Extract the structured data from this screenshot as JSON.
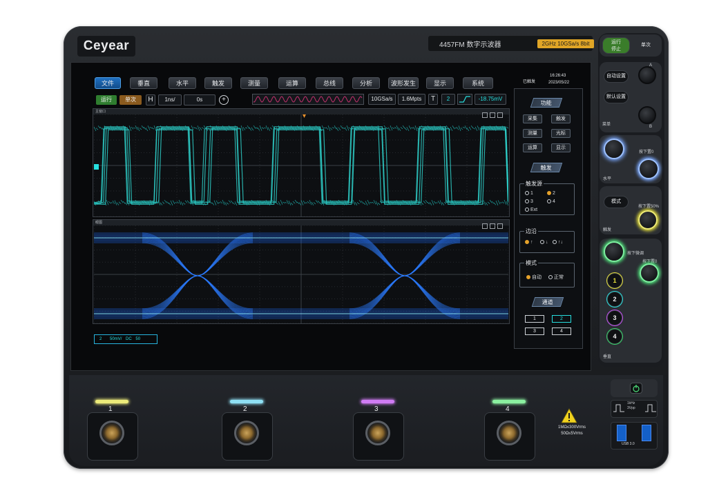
{
  "device": {
    "brand": "Ceyear",
    "model": "4457FM 数字示波器",
    "spec": "2GHz 10GSa/s 8bit",
    "run_stop": "运行\n停止",
    "single": "单次"
  },
  "menu": [
    "文件",
    "垂直",
    "水平",
    "触发",
    "测量",
    "运算",
    "总线",
    "分析",
    "波形发生",
    "显示",
    "系统"
  ],
  "status": {
    "trig_state": "已触发",
    "time": "16:26:43",
    "date": "2023/05/22"
  },
  "toolbar": {
    "run": "运行",
    "single": "单次",
    "h_label": "H",
    "timebase": "1ns/",
    "delay": "0s",
    "plus": "+",
    "sample_rate": "10GSa/s",
    "memory": "1.6Mpts",
    "t_label": "T",
    "trig_ch": "2",
    "trig_level": "-18.75mV"
  },
  "windows": {
    "top_title": "主窗口",
    "bottom_title": "眼图",
    "channel_box": {
      "ch": "2",
      "scale": "50mV/",
      "coupling": "DC",
      "imp": "50"
    }
  },
  "side": {
    "func_head": "功能",
    "func_buttons": [
      "采集",
      "触发",
      "测量",
      "光标",
      "运算",
      "显示"
    ],
    "trig_head": "触发",
    "source_title": "触发源",
    "sources": [
      "1",
      "2",
      "3",
      "4",
      "Ext"
    ],
    "source_selected": "2",
    "edge_title": "边沿",
    "edge_options": [
      "↑",
      "↓",
      "↑↓"
    ],
    "mode_title": "模式",
    "mode_options": [
      "自动",
      "正常"
    ],
    "mode_selected": "自动",
    "channel_head": "通道",
    "channels": [
      "1",
      "2",
      "3",
      "4"
    ]
  },
  "right_panel": {
    "auto_setup": "自动设置",
    "default_setup": "默认设置",
    "knob_a": "A",
    "knob_b": "B",
    "multi_label": "菜单",
    "horizontal_label": "水平",
    "press_zero": "按下置0",
    "mode_btn": "模式",
    "press_50": "按下置50%",
    "trigger_label": "触发",
    "press_fine": "按下微调",
    "press_zero2": "按下置0",
    "vertical_label": "垂直",
    "channel_nums": [
      "1",
      "2",
      "3",
      "4"
    ],
    "channel_colors": [
      "#e8e23a",
      "#27e0e0",
      "#c24ef0",
      "#37d46a"
    ]
  },
  "front": {
    "inputs": [
      "1",
      "2",
      "3",
      "4"
    ],
    "warn_line1": "1MΩ≤300Vrms",
    "warn_line2": "50Ω≤5Vrms",
    "cal_label": "1kHz\n3Vpp",
    "usb_label": "USB 3.0"
  }
}
